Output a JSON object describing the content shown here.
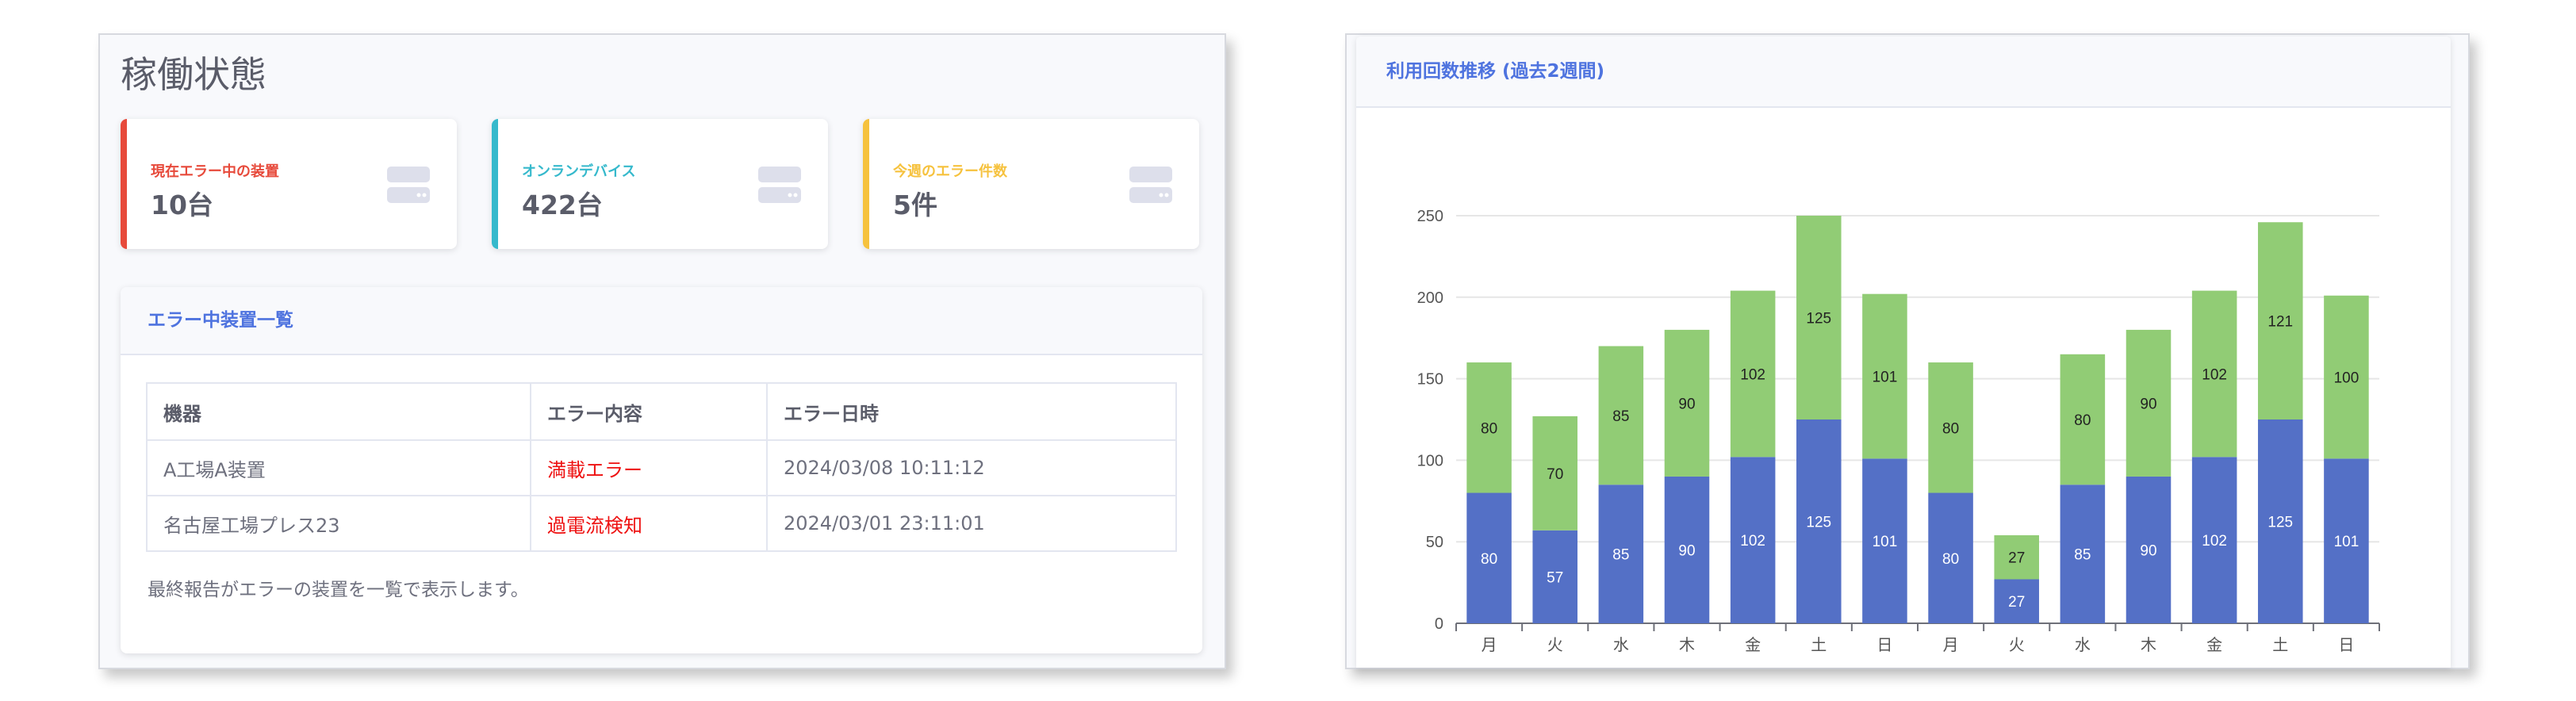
{
  "status": {
    "title": "稼働状態",
    "cards": [
      {
        "label": "現在エラー中の装置",
        "value": "10台",
        "color": "#e74a3b",
        "icon": "server-icon"
      },
      {
        "label": "オンランデバイス",
        "value": "422台",
        "color": "#36b9cc",
        "icon": "server-icon"
      },
      {
        "label": "今週のエラー件数",
        "value": "5件",
        "color": "#f6c23e",
        "icon": "server-icon"
      }
    ],
    "error_list": {
      "header": "エラー中装置一覧",
      "columns": [
        "機器",
        "エラー内容",
        "エラー日時"
      ],
      "rows": [
        [
          "A工場A装置",
          "満載エラー",
          "2024/03/08 10:11:12"
        ],
        [
          "名古屋工場プレス23",
          "過電流検知",
          "2024/03/01 23:11:01"
        ]
      ],
      "note": "最終報告がエラーの装置を一覧で表示します。"
    }
  },
  "usage": {
    "header": "利用回数推移 (過去2週間)"
  },
  "chart_data": {
    "type": "bar",
    "stacked": true,
    "categories": [
      "月",
      "火",
      "水",
      "木",
      "金",
      "土",
      "日",
      "月",
      "火",
      "水",
      "木",
      "金",
      "土",
      "日"
    ],
    "series": [
      {
        "color": "#5470c6",
        "values": [
          80,
          57,
          85,
          90,
          102,
          125,
          101,
          80,
          27,
          85,
          90,
          102,
          125,
          101
        ]
      },
      {
        "color": "#91cc75",
        "values": [
          80,
          70,
          85,
          90,
          102,
          125,
          101,
          80,
          27,
          80,
          90,
          102,
          121,
          100
        ]
      }
    ],
    "ylim": [
      0,
      250
    ],
    "yticks": [
      0,
      50,
      100,
      150,
      200,
      250
    ],
    "grid": true,
    "data_labels": true
  }
}
